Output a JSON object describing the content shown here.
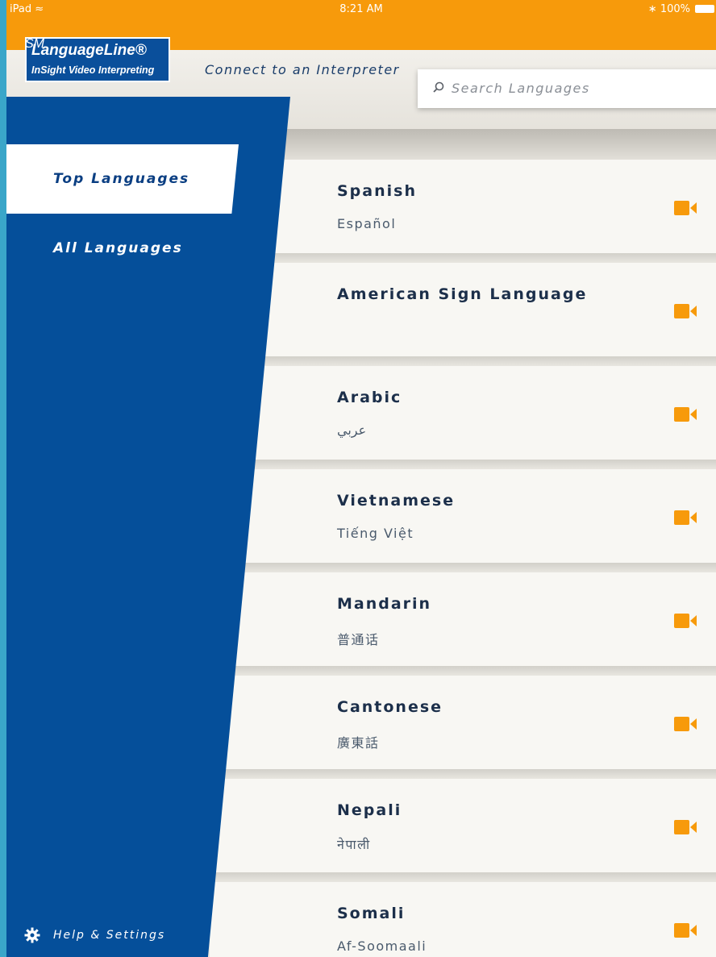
{
  "status_bar": {
    "device": "iPad",
    "time": "8:21 AM",
    "battery": "100%"
  },
  "header": {
    "logo_line1": "LanguageLine®",
    "logo_line2": "InSight Video Interpreting",
    "logo_sm": "SM",
    "tagline": "Connect to an Interpreter",
    "search_placeholder": "Search Languages"
  },
  "sidebar": {
    "items": [
      {
        "label": "Top Languages",
        "selected": true
      },
      {
        "label": "All Languages",
        "selected": false
      }
    ],
    "help_label": "Help & Settings"
  },
  "languages": [
    {
      "name": "Spanish",
      "native": "Español"
    },
    {
      "name": "American Sign Language",
      "native": ""
    },
    {
      "name": "Arabic",
      "native": "عربي"
    },
    {
      "name": "Vietnamese",
      "native": "Tiếng Việt"
    },
    {
      "name": "Mandarin",
      "native": "普通话"
    },
    {
      "name": "Cantonese",
      "native": "廣東話"
    },
    {
      "name": "Nepali",
      "native": "नेपाली"
    },
    {
      "name": "Somali",
      "native": "Af-Soomaali"
    }
  ],
  "colors": {
    "accent_orange": "#f79a0b",
    "sidebar_blue": "#054f9a",
    "text_dark": "#1c2f4a"
  }
}
